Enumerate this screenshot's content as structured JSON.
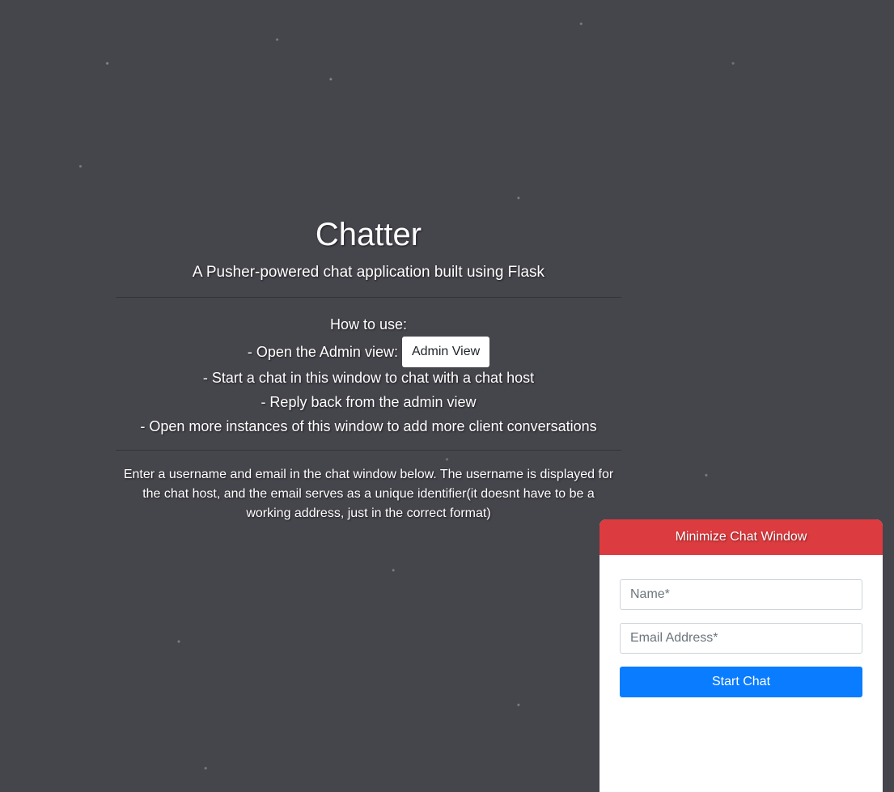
{
  "hero": {
    "title": "Chatter",
    "subtitle": "A Pusher-powered chat application built using Flask"
  },
  "instructions": {
    "heading": "How to use:",
    "admin_prefix": "- Open the Admin view:",
    "admin_button": "Admin View",
    "steps": [
      "- Start a chat in this window to chat with a chat host",
      "- Reply back from the admin view",
      "- Open more instances of this window to add more client conversations"
    ],
    "note": "Enter a username and email in the chat window below. The username is displayed for the chat host, and the email serves as a unique identifier(it doesnt have to be a working address, just in the correct format)"
  },
  "chat_window": {
    "header": "Minimize Chat Window",
    "name_placeholder": "Name*",
    "email_placeholder": "Email Address*",
    "start_button": "Start Chat"
  },
  "colors": {
    "background": "#45454c",
    "chat_header": "#dc3b3f",
    "primary_button": "#0a7cff"
  }
}
